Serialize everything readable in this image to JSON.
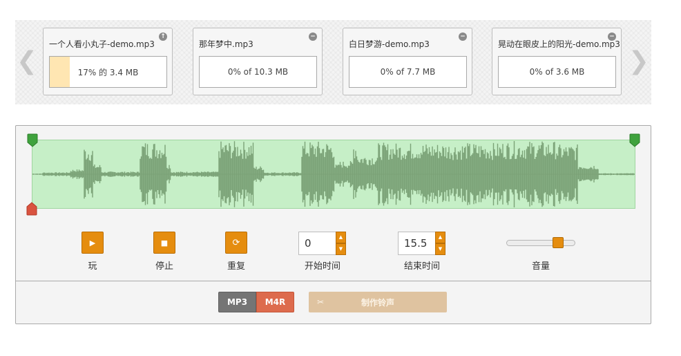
{
  "carousel": {
    "prev_glyph": "❮",
    "next_glyph": "❯",
    "files": [
      {
        "name": "一个人看小丸子-demo.mp3",
        "status": "17% 的 3.4 MB",
        "progress": 0.17,
        "action_icon": "upload-icon",
        "action_glyph": "↑"
      },
      {
        "name": "那年梦中.mp3",
        "status": "0% of 10.3 MB",
        "progress": 0,
        "action_icon": "remove-icon",
        "action_glyph": "−"
      },
      {
        "name": "白日梦游-demo.mp3",
        "status": "0% of 7.7 MB",
        "progress": 0,
        "action_icon": "remove-icon",
        "action_glyph": "−"
      },
      {
        "name": "晃动在眼皮上的阳光-demo.mp3",
        "status": "0% of 3.6 MB",
        "progress": 0,
        "action_icon": "remove-icon",
        "action_glyph": "−"
      }
    ]
  },
  "controls": {
    "play_label": "玩",
    "stop_label": "停止",
    "repeat_label": "重复",
    "start_time_label": "开始时间",
    "start_time_value": "0",
    "end_time_label": "结束时间",
    "end_time_value": "15.5",
    "volume_label": "音量",
    "volume_level": 0.78
  },
  "output": {
    "mp3_label": "MP3",
    "m4r_label": "M4R",
    "make_label": "制作铃声",
    "scissors_glyph": "✂"
  },
  "colors": {
    "accent": "#e58d0f",
    "waveform": "#7ba277",
    "waveform_bg": "#c6efc7",
    "handle_green": "#3fa23d",
    "handle_red": "#d9533f",
    "m4r": "#dd6b4d",
    "mp3": "#757575",
    "make_button": "#dfc3a0"
  }
}
